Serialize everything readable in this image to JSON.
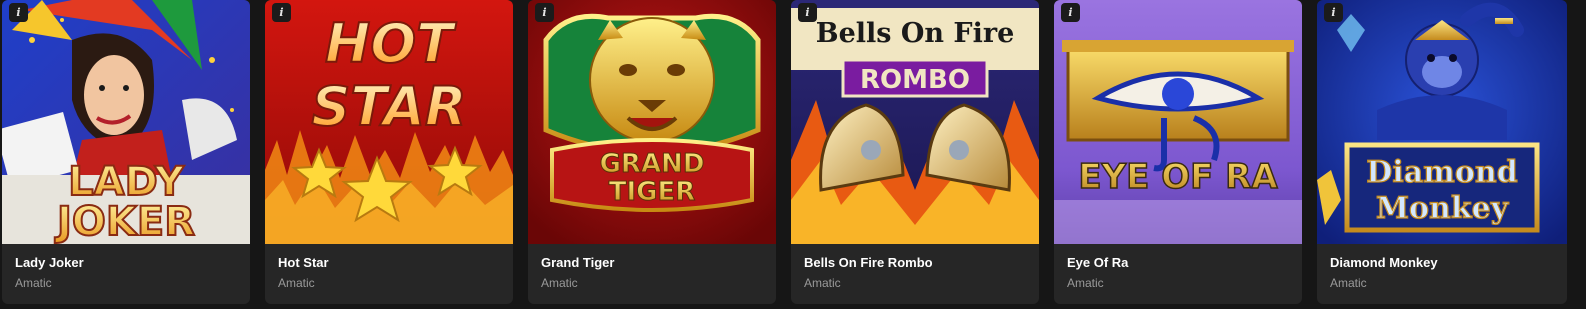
{
  "games": [
    {
      "title": "Lady Joker",
      "provider": "Amatic",
      "info_glyph": "i",
      "art_text": [
        "LADY",
        "JOKER"
      ]
    },
    {
      "title": "Hot Star",
      "provider": "Amatic",
      "info_glyph": "i",
      "art_text": [
        "HOT",
        "STAR"
      ]
    },
    {
      "title": "Grand Tiger",
      "provider": "Amatic",
      "info_glyph": "i",
      "art_text": [
        "GRAND",
        "TIGER"
      ]
    },
    {
      "title": "Bells On Fire Rombo",
      "provider": "Amatic",
      "info_glyph": "i",
      "art_text": [
        "Bells On Fire",
        "ROMBO"
      ]
    },
    {
      "title": "Eye Of Ra",
      "provider": "Amatic",
      "info_glyph": "i",
      "art_text": [
        "EYE OF RA"
      ]
    },
    {
      "title": "Diamond Monkey",
      "provider": "Amatic",
      "info_glyph": "i",
      "art_text": [
        "Diamond",
        "Monkey"
      ]
    }
  ],
  "colors": {
    "page_bg": "#161616",
    "card_bg": "#262626",
    "title": "#ffffff",
    "provider": "#9a9a9a",
    "gold": "#f2c12e"
  }
}
